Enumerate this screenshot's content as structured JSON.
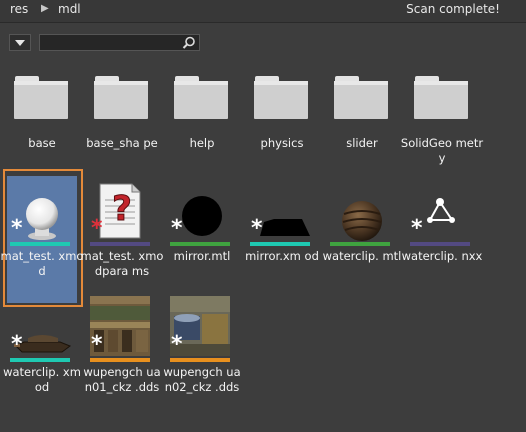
{
  "breadcrumb": {
    "root": "res",
    "sep": "▶",
    "current": "mdl"
  },
  "status": "Scan complete!",
  "search": {
    "value": "",
    "placeholder": ""
  },
  "icons": {
    "filter": "filter-dropdown-icon",
    "search": "search-icon",
    "folder": "folder-icon"
  },
  "colors": {
    "selection": "#5b7aa8",
    "selection_border": "#e48a3a",
    "teal": "#1fc9b2",
    "purple": "#534a82",
    "green": "#3fa33f",
    "orange": "#e8901e"
  },
  "folders": [
    {
      "label": "base"
    },
    {
      "label": "base_sha pe"
    },
    {
      "label": "help"
    },
    {
      "label": "physics"
    },
    {
      "label": "slider"
    },
    {
      "label": "SolidGeo metry"
    }
  ],
  "files": [
    {
      "label": "mat_test. xmod",
      "type": "xmod",
      "selected": true
    },
    {
      "label": "mat_test. xmodpara ms",
      "type": "xmodparams",
      "selected": false
    },
    {
      "label": "mirror.mtl",
      "type": "mtl",
      "selected": false
    },
    {
      "label": "mirror.xm od",
      "type": "xmod",
      "selected": false
    },
    {
      "label": "waterclip. mtl",
      "type": "mtl",
      "selected": false
    },
    {
      "label": "waterclip. nxx",
      "type": "nxx",
      "selected": false
    },
    {
      "label": "waterclip. xmod",
      "type": "xmod",
      "selected": false
    },
    {
      "label": "wupengch uan01_ckz .dds",
      "type": "dds",
      "selected": false
    },
    {
      "label": "wupengch uan02_ckz .dds",
      "type": "dds",
      "selected": false
    }
  ],
  "asterisk": "*"
}
